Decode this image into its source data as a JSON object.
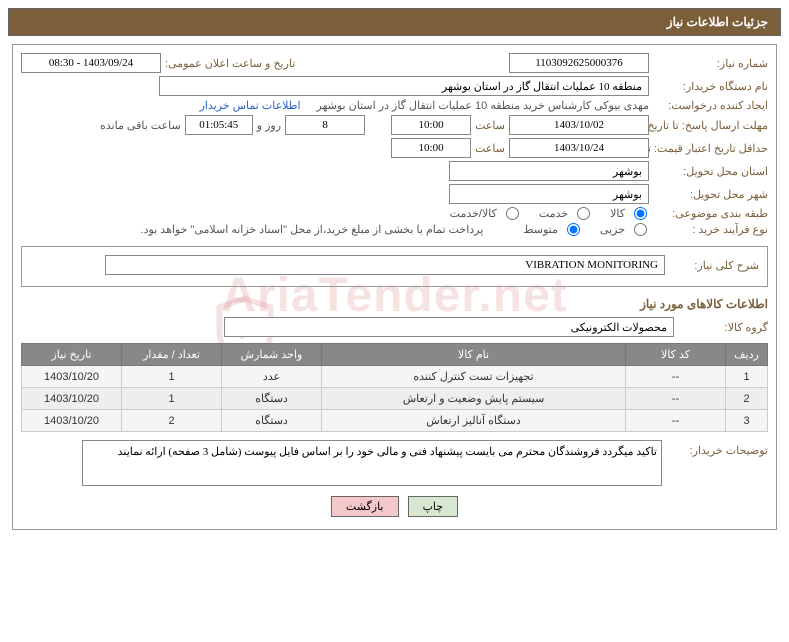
{
  "header": {
    "title": "جزئیات اطلاعات نیاز"
  },
  "watermark": {
    "text": "AriaTender.net"
  },
  "form": {
    "need_no_label": "شماره نیاز:",
    "need_no": "1103092625000376",
    "announce_label": "تاریخ و ساعت اعلان عمومی:",
    "announce_value": "1403/09/24 - 08:30",
    "buyer_label": "نام دستگاه خریدار:",
    "buyer_value": "منطقه 10 عملیات انتقال گاز در استان بوشهر",
    "requester_label": "ایجاد کننده درخواست:",
    "requester_value": "مهدی بیوکی کارشناس خرید منطقه 10 عملیات انتقال گاز در استان بوشهر",
    "contact_link": "اطلاعات تماس خریدار",
    "deadline_label": "مهلت ارسال پاسخ: تا تاریخ:",
    "deadline_date": "1403/10/02",
    "time_label": "ساعت",
    "deadline_time": "10:00",
    "days_value": "8",
    "days_suffix": "روز و",
    "remaining_time": "01:05:45",
    "remaining_label": "ساعت باقی مانده",
    "validity_label": "حداقل تاریخ اعتبار قیمت: تا تاریخ:",
    "validity_date": "1403/10/24",
    "validity_time": "10:00",
    "province_label": "استان محل تحویل:",
    "province_value": "بوشهر",
    "city_label": "شهر محل تحویل:",
    "city_value": "بوشهر",
    "category_label": "طبقه بندی موضوعی:",
    "cat_goods": "کالا",
    "cat_service": "خدمت",
    "cat_both": "کالا/خدمت",
    "purchase_type_label": "نوع فرآیند خرید :",
    "pt_small": "جزیی",
    "pt_medium": "متوسط",
    "purchase_note": "پرداخت تمام یا بخشی از مبلغ خرید،از محل \"اسناد خزانه اسلامی\" خواهد بود.",
    "need_desc_label": "شرح کلی نیاز:",
    "need_desc_value": "VIBRATION MONITORING",
    "goods_section_title": "اطلاعات کالاهای مورد نیاز",
    "group_label": "گروه کالا:",
    "group_value": "محصولات الکترونیکی",
    "buyer_notes_label": "توضیحات خریدار:",
    "buyer_notes_value": "تاکید میگردد فروشندگان محترم می بایست پیشنهاد فنی و مالی خود را بر اساس فایل پیوست (شامل 3 صفحه) ارائه نمایند"
  },
  "table": {
    "headers": {
      "row": "ردیف",
      "code": "کد کالا",
      "name": "نام کالا",
      "unit": "واحد شمارش",
      "qty": "تعداد / مقدار",
      "date": "تاریخ نیاز"
    },
    "rows": [
      {
        "row": "1",
        "code": "--",
        "name": "تجهیزات تست کنترل کننده",
        "unit": "عدد",
        "qty": "1",
        "date": "1403/10/20"
      },
      {
        "row": "2",
        "code": "--",
        "name": "سیستم پایش وضعیت و ارتعاش",
        "unit": "دستگاه",
        "qty": "1",
        "date": "1403/10/20"
      },
      {
        "row": "3",
        "code": "--",
        "name": "دستگاه آنالیز ارتعاش",
        "unit": "دستگاه",
        "qty": "2",
        "date": "1403/10/20"
      }
    ]
  },
  "buttons": {
    "print": "چاپ",
    "back": "بازگشت"
  }
}
